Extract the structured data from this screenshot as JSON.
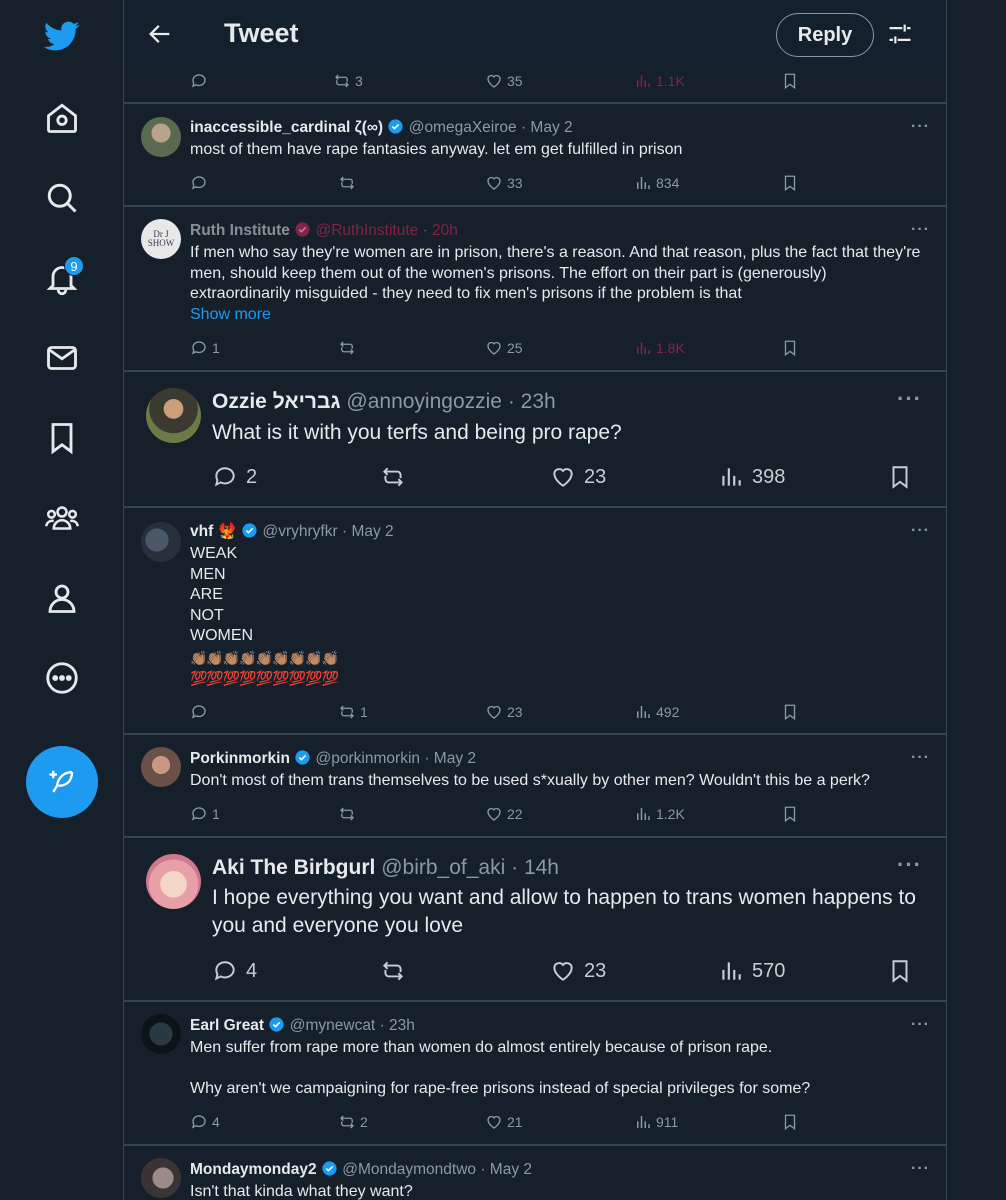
{
  "header": {
    "title": "Tweet",
    "reply_label": "Reply"
  },
  "nav": {
    "notifications_count": "9"
  },
  "top_partial": {
    "retweets": "3",
    "likes": "35",
    "views": "1.1K"
  },
  "tweets": [
    {
      "name": "inaccessible_cardinal ζ(∞)",
      "handle": "@omegaXeiroe",
      "time": "May 2",
      "text": "most of them have rape fantasies anyway. let em get fulfilled in prison",
      "replies": "",
      "retweets": "",
      "likes": "33",
      "views": "834"
    },
    {
      "name": "Ruth Institute",
      "handle": "@RuthInstitute",
      "time": "20h",
      "text": "If men who say they're women are in prison, there's a reason. And that reason, plus the fact that they're men, should keep them out of the women's prisons. The effort on their part is (generously) extraordinarily misguided - they need to fix men's prisons if the problem is that",
      "show_more": "Show more",
      "replies": "1",
      "retweets": "",
      "likes": "25",
      "views": "1.8K"
    },
    {
      "name": "Ozzie גבריאל",
      "handle": "@annoyingozzie",
      "time": "23h",
      "text": "What is it with you terfs and being pro rape?",
      "replies": "2",
      "retweets": "",
      "likes": "23",
      "views": "398"
    },
    {
      "name": "vhf",
      "handle": "@vryhryfkr",
      "time": "May 2",
      "text": "WEAK\nMEN\nARE\nNOT\nWOMEN",
      "emoji_line1": "👏🏽👏🏽👏🏽👏🏽👏🏽👏🏽👏🏽👏🏽👏🏽",
      "emoji_line2": "💯💯💯💯💯💯💯💯💯",
      "replies": "",
      "retweets": "1",
      "likes": "23",
      "views": "492"
    },
    {
      "name": "Porkinmorkin",
      "handle": "@porkinmorkin",
      "time": "May 2",
      "text": "Don't most of them trans themselves to be used s*xually by other men? Wouldn't this be a perk?",
      "replies": "1",
      "retweets": "",
      "likes": "22",
      "views": "1.2K"
    },
    {
      "name": "Aki The Birbgurl",
      "handle": "@birb_of_aki",
      "time": "14h",
      "text": "I hope everything you want and allow to happen to trans women happens to you and everyone you love",
      "replies": "4",
      "retweets": "",
      "likes": "23",
      "views": "570"
    },
    {
      "name": "Earl Great",
      "handle": "@mynewcat",
      "time": "23h",
      "text": "Men suffer from rape more than women do almost entirely because of prison rape.\n\nWhy aren't we campaigning for rape-free prisons instead of special privileges for some?",
      "replies": "4",
      "retweets": "2",
      "likes": "21",
      "views": "911"
    },
    {
      "name": "Mondaymonday2",
      "handle": "@Mondaymondtwo",
      "time": "May 2",
      "text": "Isn't that kinda what they want?"
    }
  ],
  "colors": {
    "background": "#15202b",
    "accent": "#1d9bf0",
    "border": "#38444d",
    "muted": "#8b98a5",
    "text": "#e7e9ea"
  }
}
